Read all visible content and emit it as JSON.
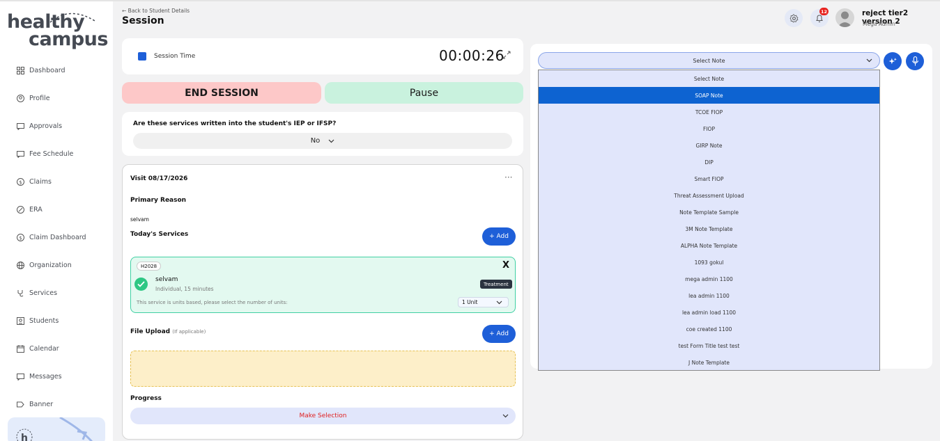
{
  "app": {
    "logo_line1": "healthy",
    "logo_line2": "campus"
  },
  "sidebar": {
    "items": [
      {
        "label": "Dashboard",
        "icon": "grid-icon"
      },
      {
        "label": "Profile",
        "icon": "user-icon"
      },
      {
        "label": "Approvals",
        "icon": "chat-icon"
      },
      {
        "label": "Fee Schedule",
        "icon": "chat-icon"
      },
      {
        "label": "Claims",
        "icon": "dollar-icon"
      },
      {
        "label": "ERA",
        "icon": "percent-icon"
      },
      {
        "label": "Claim Dashboard",
        "icon": "dollar-icon"
      },
      {
        "label": "Organization",
        "icon": "globe-icon"
      },
      {
        "label": "Services",
        "icon": "stethoscope-icon"
      },
      {
        "label": "Students",
        "icon": "id-card-icon"
      },
      {
        "label": "Calendar",
        "icon": "calendar-icon"
      },
      {
        "label": "Messages",
        "icon": "chat-icon"
      },
      {
        "label": "Banner",
        "icon": "banner-icon"
      }
    ]
  },
  "header": {
    "back_label": "Back to Student Details",
    "title": "Session",
    "notification_count": "12",
    "user_name": "reject tier2 version 2",
    "user_role": "Mega Admin"
  },
  "session": {
    "time_label": "Session Time",
    "timer": "00:00:26",
    "end_label": "END SESSION",
    "pause_label": "Pause",
    "iep_question": "Are these services written into the student's IEP or IFSP?",
    "iep_value": "No"
  },
  "visit": {
    "title": "Visit 08/17/2026",
    "primary_reason_label": "Primary Reason",
    "primary_reason_value": "selvam",
    "services_label": "Today's Services",
    "add_label": "+ Add",
    "service": {
      "code": "H2028",
      "name": "selvam",
      "detail": "Individual, 15 minutes",
      "tag": "Treatment",
      "units_note": "This service is units based, please select the number of units:",
      "unit_value": "1 Unit",
      "close": "X"
    },
    "file_upload_label": "File Upload",
    "file_upload_hint": "(If applicable)",
    "progress_label": "Progress",
    "progress_value": "Make Selection"
  },
  "notes": {
    "select_value": "Select Note",
    "options": [
      "Select Note",
      "SOAP Note",
      "TCOE FIOP",
      "FIOP",
      "GIRP Note",
      "DIP",
      "Smart FIOP",
      "Threat Assessment Upload",
      "Note Template Sample",
      "3M Note Template",
      "ALPHA Note Template",
      "1093 gokul",
      "mega admin 1100",
      "lea admin 1100",
      "lea admin load 1100",
      "coe created 1100",
      "test Form Title test test",
      "J Note Template"
    ],
    "selected_index": 1
  },
  "colors": {
    "accent": "#1e5fd8",
    "end": "#fdc8c8",
    "pause": "#c9f2de",
    "service_bg": "#e3f9f0"
  }
}
